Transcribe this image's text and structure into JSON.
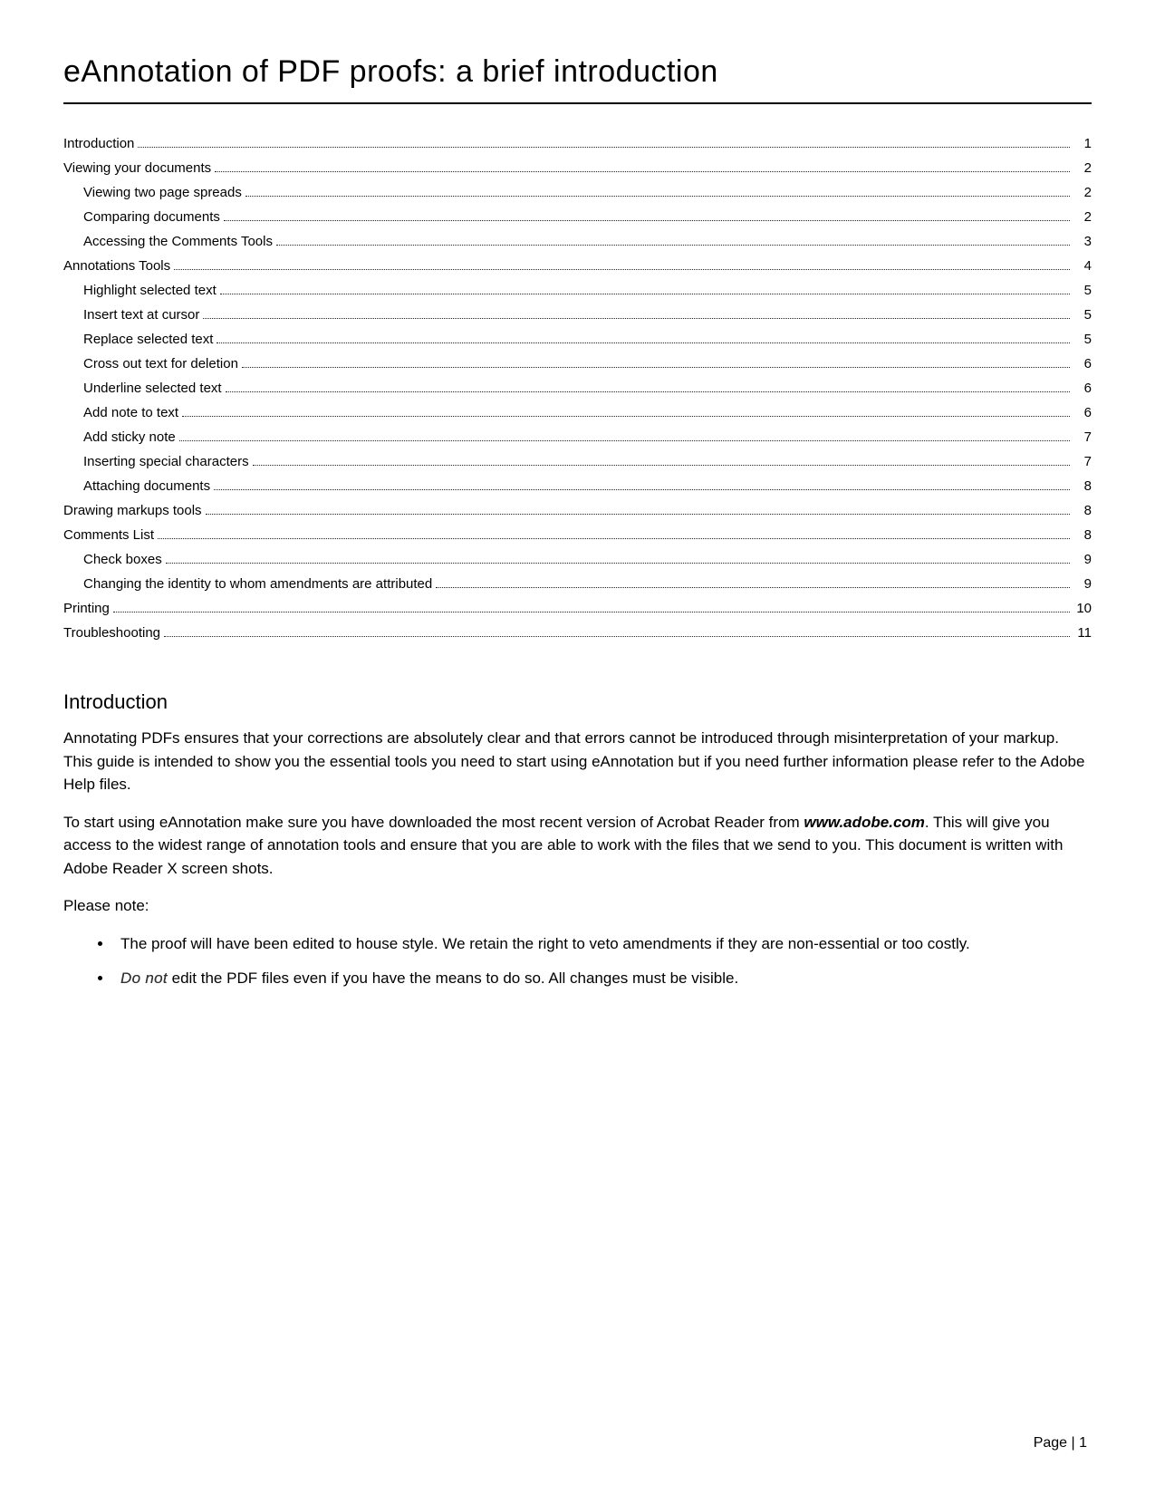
{
  "title": "eAnnotation of PDF proofs: a brief introduction",
  "toc": [
    {
      "label": "Introduction",
      "page": "1",
      "indent": 0
    },
    {
      "label": "Viewing your documents",
      "page": "2",
      "indent": 0
    },
    {
      "label": "Viewing two page spreads",
      "page": "2",
      "indent": 1
    },
    {
      "label": "Comparing documents",
      "page": "2",
      "indent": 1
    },
    {
      "label": "Accessing the Comments Tools",
      "page": "3",
      "indent": 1
    },
    {
      "label": "Annotations Tools",
      "page": "4",
      "indent": 0
    },
    {
      "label": "Highlight selected text",
      "page": "5",
      "indent": 1
    },
    {
      "label": "Insert text at cursor",
      "page": "5",
      "indent": 1
    },
    {
      "label": "Replace selected text",
      "page": "5",
      "indent": 1
    },
    {
      "label": "Cross out text for deletion",
      "page": "6",
      "indent": 1
    },
    {
      "label": "Underline selected text",
      "page": "6",
      "indent": 1
    },
    {
      "label": "Add note to text",
      "page": "6",
      "indent": 1
    },
    {
      "label": "Add sticky note",
      "page": "7",
      "indent": 1
    },
    {
      "label": "Inserting special characters",
      "page": "7",
      "indent": 1
    },
    {
      "label": "Attaching documents",
      "page": "8",
      "indent": 1
    },
    {
      "label": "Drawing markups tools",
      "page": "8",
      "indent": 0
    },
    {
      "label": "Comments List",
      "page": "8",
      "indent": 0
    },
    {
      "label": "Check boxes",
      "page": "9",
      "indent": 1
    },
    {
      "label": "Changing the identity to whom amendments are attributed",
      "page": "9",
      "indent": 1
    },
    {
      "label": "Printing",
      "page": "10",
      "indent": 0
    },
    {
      "label": "Troubleshooting",
      "page": "11",
      "indent": 0
    }
  ],
  "section_heading": "Introduction",
  "para1": "Annotating PDFs ensures that your corrections are absolutely clear and that errors cannot be introduced through misinterpretation of your markup. This guide is intended to show you the essential tools you need to start using eAnnotation but if you need further information please refer to the Adobe Help files.",
  "para2_a": "To start using eAnnotation make sure you have downloaded the most recent version of Acrobat Reader from ",
  "para2_link": "www.adobe.com",
  "para2_b": ". This will give you access to the widest range of annotation tools and ensure that you are able to work with the files that we send to you. This document is written with Adobe Reader X screen shots.",
  "please_note": "Please note:",
  "bullet1": "The proof will have been edited to house style. We retain the right to veto amendments if they are non-essential or too costly.",
  "bullet2_a": "Do not",
  "bullet2_b": " edit the PDF files even if you have the means to do so. All changes must be visible.",
  "footer": "Page | 1"
}
